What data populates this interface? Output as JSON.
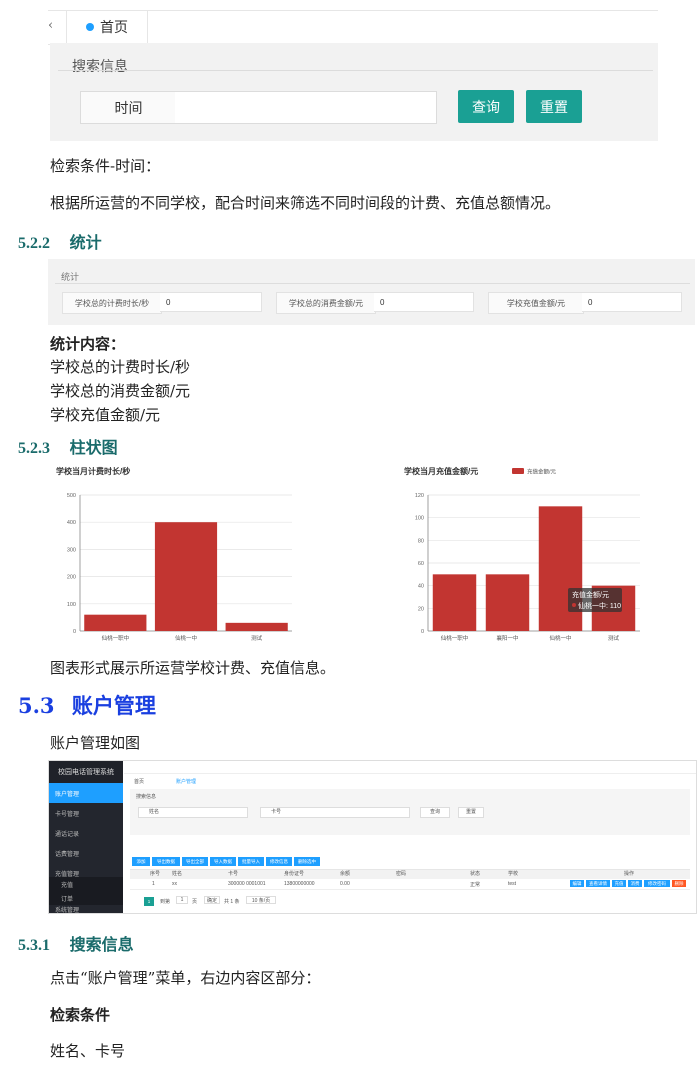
{
  "tabbar": {
    "left_arrow": "‹",
    "home_tab": "首页"
  },
  "search": {
    "legend": "搜索信息",
    "time_label": "时间",
    "time_value": "",
    "query_btn": "查询",
    "reset_btn": "重置"
  },
  "text": {
    "cond_time": "检索条件-时间：",
    "cond_desc": "根据所运营的不同学校，配合时间来筛选不同时间段的计费、充值总额情况。",
    "stat_heading_num": "5.2.2",
    "stat_heading": "统计",
    "stat_content_title": "统计内容：",
    "stat_line1": "学校总的计费时长/秒",
    "stat_line2": "学校总的消费金额/元",
    "stat_line3": "学校充值金额/元",
    "bar_heading_num": "5.2.3",
    "bar_heading": "柱状图",
    "chart_desc": "图表形式展示所运营学校计费、充值信息。",
    "acct_heading_num": "5.3",
    "acct_heading": "账户管理",
    "acct_desc": "账户管理如图",
    "search_heading_num": "5.3.1",
    "search_heading": "搜索信息",
    "click_desc": "点击“账户管理”菜单，右边内容区部分：",
    "search_cond_title": "检索条件",
    "search_cond_fields": "姓名、卡号"
  },
  "stats": {
    "legend": "统计",
    "items": [
      {
        "label": "学校总的计费时长/秒",
        "value": "0"
      },
      {
        "label": "学校总的消费金额/元",
        "value": "0"
      },
      {
        "label": "学校充值金额/元",
        "value": "0"
      }
    ]
  },
  "colors": {
    "accent_green": "#1aa094",
    "bar_red": "#c23531",
    "heading_teal": "#1a6b6b",
    "heading_blue": "#1a3fe0",
    "nav_blue": "#1e9fff"
  },
  "chart_data": [
    {
      "type": "bar",
      "title": "学校当月计费时长/秒",
      "categories": [
        "仙桃一职中",
        "仙桃一中",
        "测试"
      ],
      "values": [
        60,
        400,
        30
      ],
      "ylim": [
        0,
        500
      ],
      "yticks": [
        "0",
        "100",
        "200",
        "300",
        "400",
        "500"
      ],
      "grid": true
    },
    {
      "type": "bar",
      "title": "学校当月充值金额/元",
      "legend": "充值金额/元",
      "legend_position": "top",
      "categories": [
        "仙桃一职中",
        "襄阳一中",
        "仙桃一中",
        "测试"
      ],
      "values": [
        50,
        50,
        110,
        40
      ],
      "ylim": [
        0,
        120
      ],
      "yticks": [
        "0",
        "20",
        "40",
        "60",
        "80",
        "100",
        "120"
      ],
      "grid": true,
      "tooltip": {
        "title": "充值金额/元",
        "label": "仙桃一中: 110"
      }
    }
  ],
  "app": {
    "side_title": "校园电话管理系统",
    "side_items": [
      "账户管理",
      "卡号管理",
      "通话记录",
      "话费管理",
      "充值管理",
      "充值",
      "订单",
      "系统管理"
    ],
    "tabs": [
      "首页",
      "账户管理"
    ],
    "search_legend": "搜索信息",
    "name_label": "姓名",
    "card_label": "卡号",
    "query": "查询",
    "reset": "重置",
    "toolbar": [
      "添加",
      "导出数据",
      "导出全部",
      "导入数据",
      "批量导入",
      "修改信息",
      "删除选中"
    ],
    "columns": [
      "序号",
      "姓名",
      "卡号",
      "身份证号",
      "余额",
      "密码",
      "状态",
      "学校",
      "操作"
    ],
    "row": [
      "1",
      "xx",
      "300000 0001001",
      "13800000000",
      "0.00",
      "",
      "正常",
      "test"
    ],
    "actions": [
      "编辑",
      "查看详情",
      "充值",
      "消费",
      "修改密码",
      "删除"
    ],
    "pager": {
      "page": "1",
      "goto_label": "到第",
      "page_input": "1",
      "page_unit": "页",
      "confirm": "确定",
      "total": "共 1 条",
      "per_page": "10 条/页"
    }
  }
}
